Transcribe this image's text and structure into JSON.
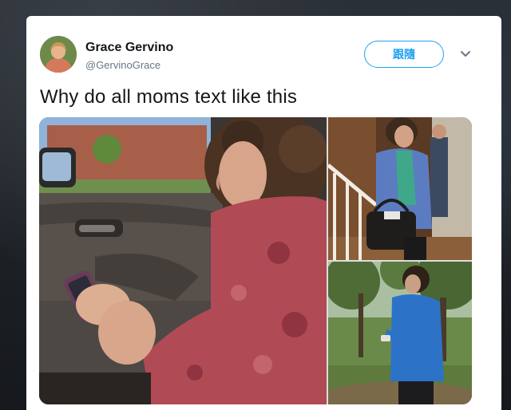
{
  "tweet": {
    "author_name": "Grace Gervino",
    "author_handle": "@GervinoGrace",
    "follow_label": "跟隨",
    "text": "Why do all moms text like this"
  },
  "icons": {
    "more": "chevron-down-icon"
  },
  "colors": {
    "accent": "#1da1f2",
    "text": "#14171a",
    "secondary": "#657786"
  }
}
